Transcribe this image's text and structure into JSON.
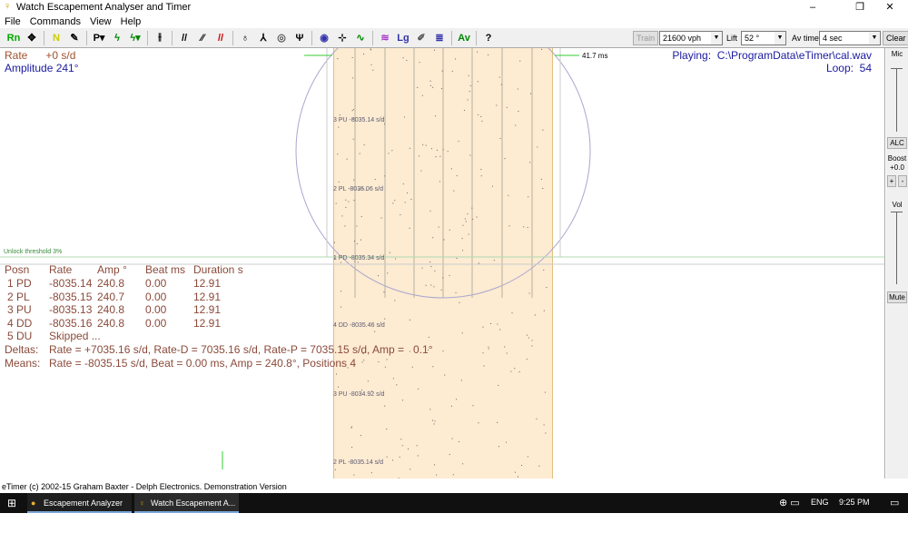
{
  "window": {
    "title": "Watch Escapement Analyser and Timer",
    "minimize": "–",
    "maximize": "❐",
    "close": "✕"
  },
  "menu": [
    "File",
    "Commands",
    "View",
    "Help"
  ],
  "toolbar": {
    "icons": [
      "run-icon",
      "move-icon",
      "note-icon",
      "wrench-icon",
      "print-icon",
      "filter-icon",
      "filter2-icon",
      "split-icon",
      "slash-icon",
      "pen-icon",
      "red-slash-icon",
      "mic-icon",
      "lift-icon",
      "target-icon",
      "fork-icon",
      "circle-icon",
      "beat-icon",
      "wave-icon",
      "pattern-icon",
      "log-icon",
      "edit-icon",
      "graph-icon",
      "av-icon",
      "help-icon"
    ],
    "train": "Train",
    "vph": "21600 vph",
    "lift_label": "Lift",
    "lift": "52 °",
    "avtime_label": "Av time",
    "avtime": "4 sec",
    "clear": "Clear"
  },
  "display": {
    "rate": "Rate      +0 s/d",
    "amplitude": "Amplitude 241°",
    "playing": "Playing:  C:\\ProgramData\\eTimer\\cal.wav",
    "loop": "Loop:  54",
    "ms": "41.7 ms",
    "threshold": "Unlock threshold 3%",
    "pos_labels": [
      "3 PU  -8035.14 s/d",
      "2 PL  -8035.06 s/d",
      "1 PD  -8035.34 s/d",
      "4 DD  -8035.46 s/d",
      "3 PU  -8034.92 s/d",
      "2 PL  -8035.14 s/d"
    ],
    "colors": {
      "band": "#fdebd2",
      "rate": "#a0522d",
      "blue": "#1a1aa0"
    }
  },
  "table": {
    "headers": [
      "Posn",
      "Rate",
      "Amp °",
      "Beat ms",
      "Duration s"
    ],
    "rows": [
      [
        "1 PD",
        "-8035.14",
        "240.8",
        "0.00",
        "12.91"
      ],
      [
        "2 PL",
        "-8035.15",
        "240.7",
        "0.00",
        "12.91"
      ],
      [
        "3 PU",
        "-8035.13",
        "240.8",
        "0.00",
        "12.91"
      ],
      [
        "4 DD",
        "-8035.16",
        "240.8",
        "0.00",
        "12.91"
      ],
      [
        "5 DU",
        "Skipped ...",
        "",
        "",
        ""
      ]
    ],
    "deltas_label": "Deltas:",
    "deltas": "Rate = +7035.16 s/d, Rate-D = 7035.16 s/d, Rate-P = 7035.15 s/d, Amp =   0.1°",
    "means_label": "Means:",
    "means": "Rate = -8035.15 s/d, Beat = 0.00 ms, Amp = 240.8°, Positions 4"
  },
  "right": {
    "mic": "Mic",
    "alc": "ALC",
    "boost": "Boost",
    "boost_val": "+0.0",
    "plus": "+",
    "minus": "-",
    "vol": "Vol",
    "mute": "Mute"
  },
  "status": "eTimer (c) 2002-15 Graham Baxter - Delph Electronics. Demonstration Version",
  "taskbar": {
    "items": [
      "Escapement Analyzer ...",
      "Watch Escapement A..."
    ],
    "lang": "ENG",
    "time": "9:25 PM"
  }
}
